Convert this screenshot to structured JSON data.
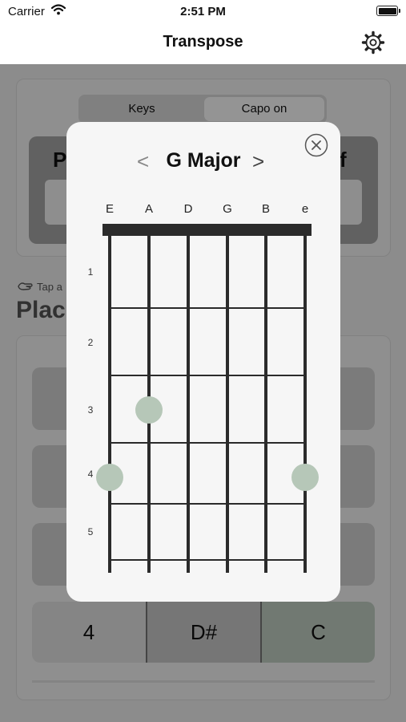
{
  "status_bar": {
    "carrier": "Carrier",
    "time": "2:51 PM"
  },
  "nav": {
    "title": "Transpose",
    "settings_icon": "gear-icon"
  },
  "background": {
    "segmented": [
      "Keys",
      "Capo on"
    ],
    "left_button_initial": "P",
    "right_button_initial": "f",
    "hint": "Tap a",
    "heading": "Plac",
    "bottom_row": [
      "4",
      "D#",
      "C"
    ]
  },
  "popup": {
    "prev_label": "<",
    "next_label": ">",
    "chord_name": "G Major",
    "close_icon": "close-icon",
    "strings": [
      "E",
      "A",
      "D",
      "G",
      "B",
      "e"
    ],
    "frets": [
      "1",
      "2",
      "3",
      "4",
      "5"
    ],
    "dots": [
      {
        "string": 1,
        "fret": 2
      },
      {
        "string": 0,
        "fret": 3
      },
      {
        "string": 5,
        "fret": 3
      }
    ],
    "colors": {
      "dot": "#b6c7b8",
      "string": "#2b2b2b",
      "nut": "#2b2b2b"
    }
  }
}
